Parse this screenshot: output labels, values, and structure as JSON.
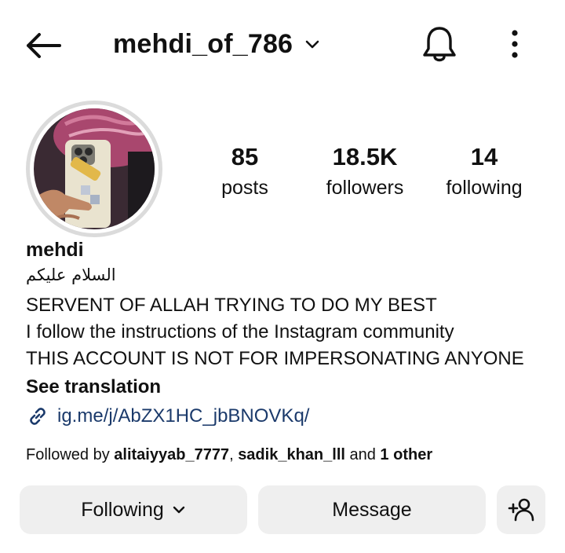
{
  "header": {
    "username": "mehdi_of_786",
    "icons": {
      "back": "back-arrow-icon",
      "dropdown": "chevron-down-icon",
      "notifications": "bell-icon",
      "more": "more-vertical-icon"
    }
  },
  "stats": {
    "posts": {
      "value": "85",
      "label": "posts"
    },
    "followers": {
      "value": "18.5K",
      "label": "followers"
    },
    "following": {
      "value": "14",
      "label": "following"
    }
  },
  "profile": {
    "display_name": "mehdi",
    "arabic_line": "السلام علیکم",
    "bio_lines": [
      "SERVENT OF ALLAH TRYING TO DO MY BEST",
      "I follow the instructions of the Instagram community",
      "THIS ACCOUNT IS NOT FOR IMPERSONATING ANYONE"
    ],
    "see_translation": "See translation",
    "link": "ig.me/j/AbZX1HC_jbBNOVKq/",
    "link_color": "#1b3a6b"
  },
  "followed_by": {
    "prefix": "Followed by ",
    "user1": "alitaiyyab_7777",
    "sep": ", ",
    "user2": "sadik_khan_lll",
    "and": " and ",
    "others": "1 other"
  },
  "actions": {
    "following_label": "Following",
    "message_label": "Message",
    "add_friend_icon": "add-person-icon",
    "button_bg": "#efefef"
  }
}
